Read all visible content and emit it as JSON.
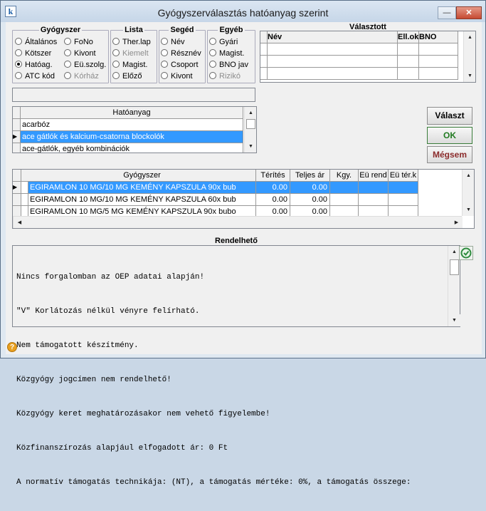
{
  "window": {
    "title": "Gyógyszerválasztás hatóanyag szerint",
    "minimize": "—",
    "maximize": "☐",
    "close": "✕"
  },
  "groups": {
    "gyogyszer": {
      "title": "Gyógyszer",
      "options": [
        "Általános",
        "FoNo",
        "Kötszer",
        "Kivont",
        "Hatóag.",
        "Eü.szolg.",
        "ATC kód",
        "Kórház"
      ],
      "selected": "Hatóag."
    },
    "lista": {
      "title": "Lista",
      "options": [
        "Ther.lap",
        "Kiemelt",
        "Magist.",
        "Előző"
      ]
    },
    "seged": {
      "title": "Segéd",
      "options": [
        "Név",
        "Résznév",
        "Csoport",
        "Kivont"
      ]
    },
    "egyeb": {
      "title": "Egyéb",
      "options": [
        "Gyári",
        "Magist.",
        "BNO jav",
        "Rizikó"
      ]
    }
  },
  "valasztott": {
    "title": "Választott",
    "columns": [
      "Név",
      "Ell.ok",
      "BNO"
    ]
  },
  "hatoanyag": {
    "header": "Hatóanyag",
    "rows": [
      "acarbóz",
      "ace gátlók és kalcium-csatorna blockolók",
      "ace-gátlók, egyéb kombinációk"
    ],
    "selected_index": 1
  },
  "buttons": {
    "valaszt": "Választ",
    "ok": "OK",
    "megsem": "Mégsem"
  },
  "gyogyszer_grid": {
    "columns": [
      "Gyógyszer",
      "Térítés",
      "Teljes ár",
      "Kgy.",
      "Eü rend",
      "Eü tér.k"
    ],
    "rows": [
      [
        "EGIRAMLON 10 MG/10 MG KEMÉNY KAPSZULA 90x bub",
        "0.00",
        "0.00",
        "",
        "",
        ""
      ],
      [
        "EGIRAMLON 10 MG/10 MG KEMÉNY KAPSZULA 60x bub",
        "0.00",
        "0.00",
        "",
        "",
        ""
      ],
      [
        "EGIRAMLON 10 MG/5 MG KEMÉNY KAPSZULA 90x bubo",
        "0.00",
        "0.00",
        "",
        "",
        ""
      ]
    ],
    "selected_index": 0
  },
  "rendelheto": {
    "title": "Rendelhető",
    "lines": [
      "Nincs forgalomban az OEP adatai alapján!",
      "\"V\" Korlátozás nélkül vényre felírható.",
      "Nem támogatott készítmény.",
      "Közgyógy jogcímen nem rendelhető!",
      "Közgyógy keret meghatározásakor nem vehető figyelembe!",
      "Közfinanszírozás alapjául elfogadott ár: 0 Ft",
      "A normatív támogatás technikája: (NT), a támogatás mértéke: 0%, a támogatás összege:"
    ]
  },
  "icons": {
    "app": "k-app-icon",
    "help": "help-icon",
    "side": "info-refresh-icon"
  },
  "colors": {
    "selection": "#3399ff",
    "ok": "#207a20",
    "cancel": "#8b2b2b"
  }
}
